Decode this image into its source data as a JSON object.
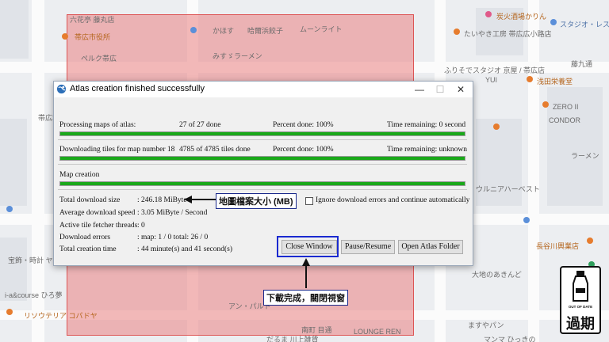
{
  "dialog": {
    "title": "Atlas creation finished successfully",
    "window_controls": {
      "minimize": "—",
      "maximize": "☐",
      "close": "✕"
    },
    "progress": [
      {
        "label": "Processing maps of atlas:",
        "count": "27 of 27 done",
        "percent": "Percent done: 100%",
        "remaining": "Time remaining: 0 second",
        "fraction": 1.0
      },
      {
        "label": "Downloading tiles for map number 18",
        "count": "4785 of 4785 tiles done",
        "percent": "Percent done: 100%",
        "remaining": "Time remaining: unknown",
        "fraction": 1.0
      },
      {
        "label": "Map creation",
        "fraction": 1.0
      }
    ],
    "stats": [
      {
        "key": "Total download size",
        "value": ": 246.18 MiByte"
      },
      {
        "key": "Average download speed",
        "value": ": 3.05 MiByte / Second"
      },
      {
        "key": "Active tile fetcher threads",
        "value": ": 0"
      },
      {
        "key": "Download errors",
        "value": ": map: 1 / 0 total: 26 / 0"
      },
      {
        "key": "Total creation time",
        "value": ": 44 minute(s) and 41 second(s)"
      }
    ],
    "checkbox_label": "Ignore download errors and continue automatically",
    "checkbox_checked": false,
    "buttons": {
      "close": "Close Window",
      "pause": "Pause/Resume",
      "open": "Open Atlas Folder"
    }
  },
  "annotations": {
    "size_note": "地圖檔案大小 (MB)",
    "close_note": "下載完成，關閉視窗"
  },
  "logo": {
    "top_text": "OUT OF DATE",
    "main_text": "過期"
  },
  "map_labels": [
    "六花亭 藤丸店",
    "帯広市役所",
    "ペルク帯広",
    "かほす",
    "哈爾浜餃子",
    "みすゞラーメン",
    "ムーンライト",
    "たいやき工房 帯広広小路店",
    "ふりそでスタジオ 京屋 / 帯広店",
    "浅田栄養堂",
    "ZERO II",
    "CONDOR",
    "長谷川興業店",
    "大地のあきんど",
    "ウルニアハーベスト",
    "宝飾・時計 ヤマダ",
    "i-a&course ひろ夢",
    "リソウテリア コパドヤ",
    "アン・パルト",
    "南町 目通",
    "LOUNGE REN",
    "だるま 川上雑貨",
    "ますやパン",
    "マンマ ひっきの",
    "スタジオ・レスト",
    "炭火酒場かりん",
    "藤九通",
    "帯広本店",
    "YUI",
    "ラーメン"
  ]
}
